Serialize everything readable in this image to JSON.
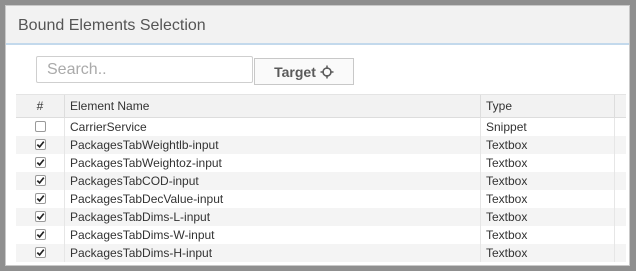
{
  "window": {
    "title": "Bound Elements Selection"
  },
  "toolbar": {
    "search_placeholder": "Search..",
    "search_value": "",
    "target_label": "Target",
    "target_icon": "crosshair-icon"
  },
  "table": {
    "columns": [
      "#",
      "Element Name",
      "Type"
    ],
    "rows": [
      {
        "checked": false,
        "name": "CarrierService",
        "type": "Snippet"
      },
      {
        "checked": true,
        "name": "PackagesTabWeightlb-input",
        "type": "Textbox"
      },
      {
        "checked": true,
        "name": "PackagesTabWeightoz-input",
        "type": "Textbox"
      },
      {
        "checked": true,
        "name": "PackagesTabCOD-input",
        "type": "Textbox"
      },
      {
        "checked": true,
        "name": "PackagesTabDecValue-input",
        "type": "Textbox"
      },
      {
        "checked": true,
        "name": "PackagesTabDims-L-input",
        "type": "Textbox"
      },
      {
        "checked": true,
        "name": "PackagesTabDims-W-input",
        "type": "Textbox"
      },
      {
        "checked": true,
        "name": "PackagesTabDims-H-input",
        "type": "Textbox"
      }
    ]
  },
  "colors": {
    "header_bg": "#f2f2f2",
    "header_accent": "#c3d9ec",
    "outer_bg": "#8f8f8f"
  }
}
